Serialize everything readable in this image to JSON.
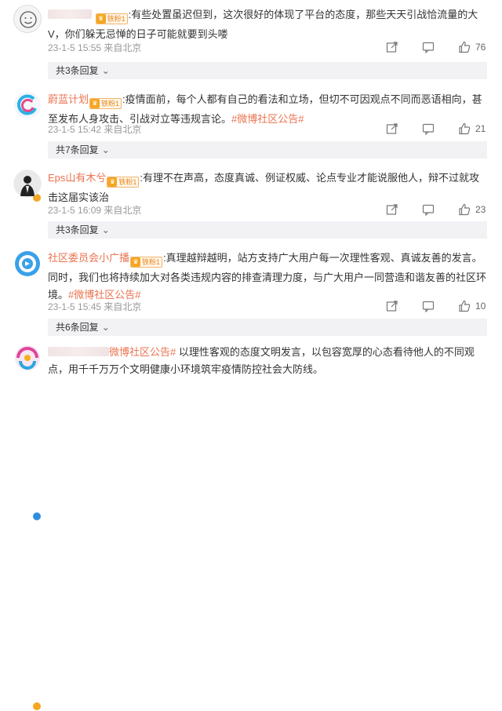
{
  "comments": [
    {
      "username": "",
      "badge": "铁粉1",
      "text": ":有些处置虽迟但到，这次很好的体现了平台的态度，那些天天引战恰流量的大V，你们躲无忌惮的日子可能就要到头喽",
      "meta": "23-1-5 15:55 来自北京",
      "likes": "76",
      "replies": "共3条回复"
    },
    {
      "username": "蔚蓝计划",
      "badge": "铁粉1",
      "text": ":疫情面前，每个人都有自己的看法和立场，但切不可因观点不同而恶语相向，甚至发布人身攻击、引战对立等违规言论。",
      "topic": "#微博社区公告#",
      "meta": "23-1-5 15:42 来自北京",
      "likes": "21",
      "replies": "共7条回复"
    },
    {
      "username": "Eps山有木兮",
      "badge": "铁粉1",
      "text": ":有理不在声高，态度真诚、例证权威、论点专业才能说服他人，辩不过就攻击这届实该治",
      "meta": "23-1-5 16:09 来自北京",
      "likes": "23",
      "replies": "共3条回复"
    },
    {
      "username": "社区委员会小广播",
      "badge": "铁粉1",
      "text": ":真理越辩越明，站方支持广大用户每一次理性客观、真诚友善的发言。同时，我们也将持续加大对各类违规内容的排查清理力度，与广大用户一同营造和谐友善的社区环境。",
      "topic": "#微博社区公告#",
      "meta": "23-1-5 15:45 来自北京",
      "likes": "10",
      "replies": "共6条回复"
    },
    {
      "username": "",
      "topic": "微博社区公告#",
      "text": "以理性客观的态度文明发言，以包容宽厚的心态看待他人的不同观点，用千千万万个文明健康小环境筑牢疫情防控社会大防线。"
    }
  ],
  "icons": {
    "share": "share-icon",
    "comment": "comment-icon",
    "like": "thumbs-up-icon",
    "chevron": "chevron-down-icon"
  },
  "colors": {
    "username": "#eb7350",
    "meta": "#999999",
    "reply_bar_bg": "#f2f2f5",
    "badge_border": "#f2b46b"
  }
}
